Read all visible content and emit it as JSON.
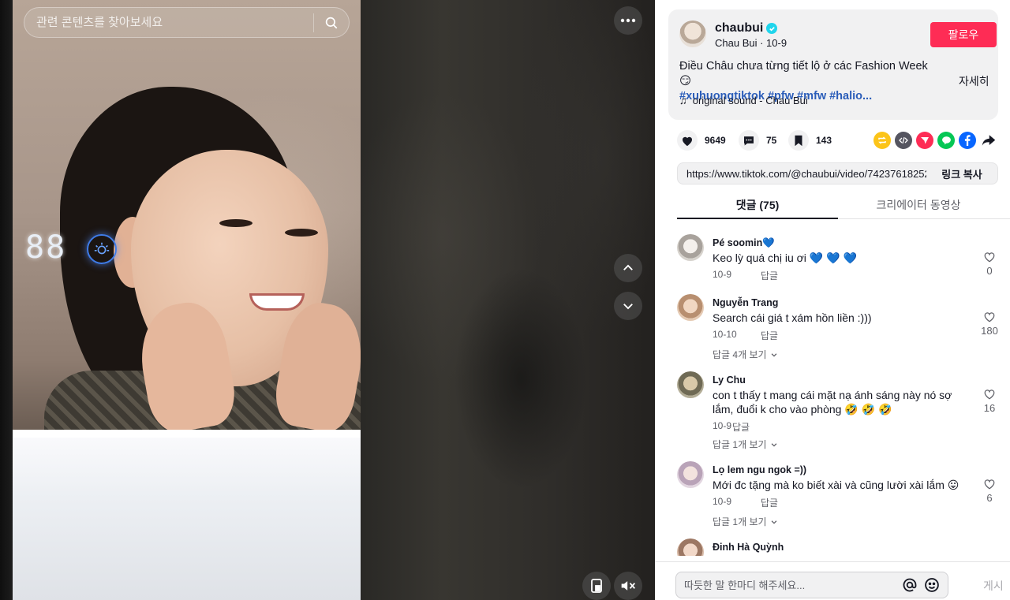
{
  "search": {
    "placeholder": "관련 콘텐츠를 찾아보세요"
  },
  "video": {
    "counter_text": "88"
  },
  "author": {
    "username": "chaubui",
    "display_name": "Chau Bui",
    "date": "10-9",
    "follow_label": "팔로우"
  },
  "caption": {
    "text": "Điều Châu chưa từng tiết lộ ở các Fashion Week 😏",
    "tags": "#xuhuongtiktok #pfw #mfw #halio...",
    "more_label": "자세히"
  },
  "sound": {
    "label": "original sound - Chau Bui"
  },
  "stats": {
    "likes": "9649",
    "comments": "75",
    "saves": "143"
  },
  "share": {
    "icons": [
      "repost-icon",
      "embed-icon",
      "send-icon",
      "line-icon",
      "facebook-icon",
      "share-arrow-icon"
    ]
  },
  "link": {
    "url": "https://www.tiktok.com/@chaubui/video/74237618252...",
    "copy_label": "링크 복사"
  },
  "tabs": [
    {
      "label": "댓글 (75)",
      "active": true
    },
    {
      "label": "크리에이터 동영상",
      "active": false
    }
  ],
  "comments": [
    {
      "name": "Pé soomin💙",
      "text": "Keo lỳ quá chị iu ơi 💙 💙 💙",
      "date": "10-9",
      "reply_label": "답글",
      "likes": "0",
      "more_replies": ""
    },
    {
      "name": "Nguyễn Trang",
      "text": "Search cái giá t xám hồn liền :)))",
      "date": "10-10",
      "reply_label": "답글",
      "likes": "180",
      "more_replies": "답글 4개 보기"
    },
    {
      "name": "Ly Chu",
      "text": "con t thấy t mang cái mặt nạ ánh sáng này nó sợ lắm, đuổi k cho vào phòng 🤣 🤣 🤣",
      "date": "10-9",
      "reply_label": "답글",
      "likes": "16",
      "more_replies": "답글 1개 보기"
    },
    {
      "name": "Lọ lem ngu ngok =))",
      "text": "Mới đc tặng mà ko biết xài và cũng lười xài lắm 😛",
      "date": "10-9",
      "reply_label": "답글",
      "likes": "6",
      "more_replies": "답글 1개 보기"
    },
    {
      "name": "Đinh Hà Quỳnh",
      "text": "",
      "date": "",
      "reply_label": "",
      "likes": "",
      "more_replies": ""
    }
  ],
  "comment_input": {
    "placeholder": "따듯한 말 한마디 해주세요...",
    "post_label": "게시"
  },
  "colors": {
    "accent": "#fe2c55",
    "tag_blue": "#2b5db9",
    "verified": "#20d5ec"
  }
}
